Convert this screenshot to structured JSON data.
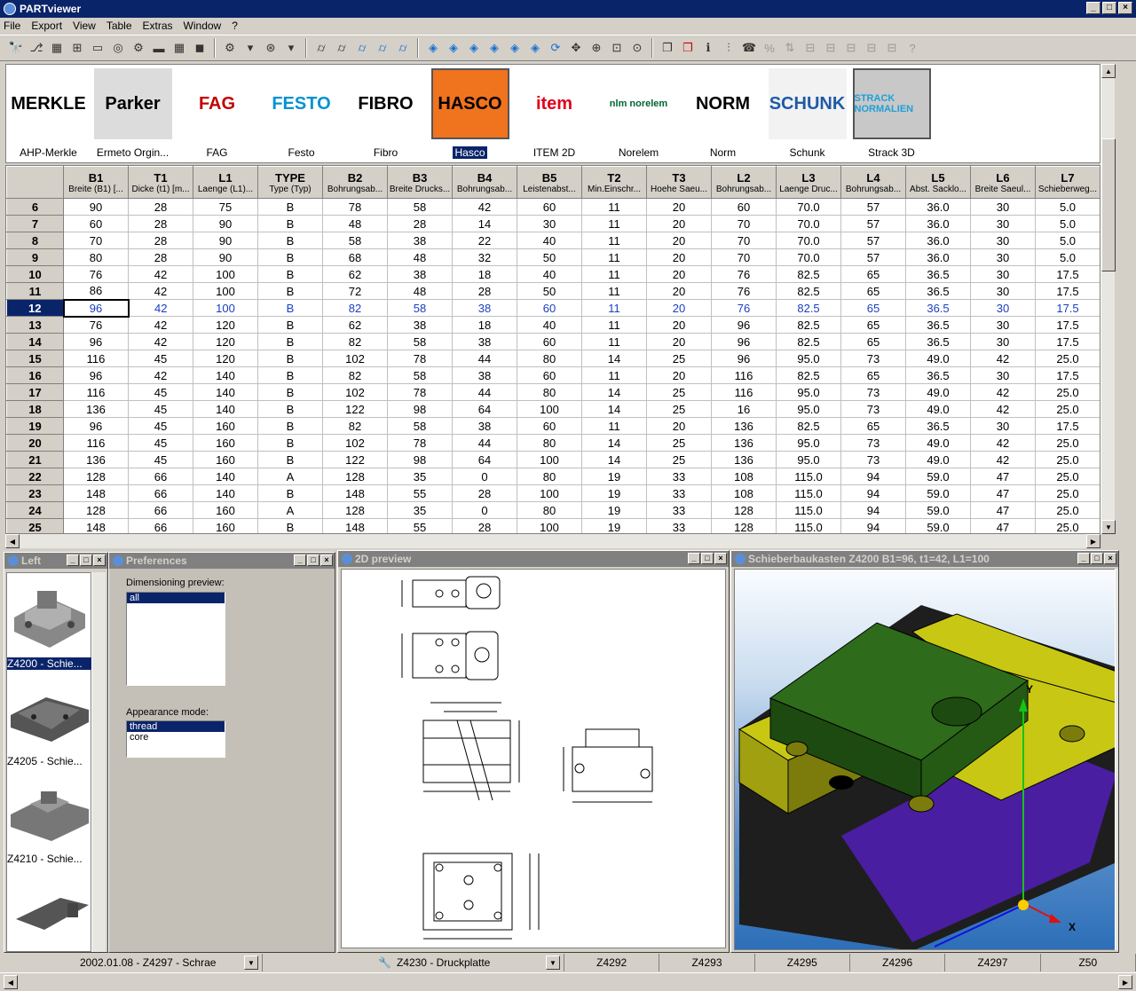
{
  "app": {
    "title": "PARTviewer"
  },
  "menu": [
    "File",
    "Export",
    "View",
    "Table",
    "Extras",
    "Window",
    "?"
  ],
  "logos": [
    {
      "label": "AHP-Merkle",
      "img": "MERKLE",
      "bg": "#ffffff",
      "fg": "#000000"
    },
    {
      "label": "Ermeto Orgin...",
      "img": "Parker",
      "bg": "#dcdcdc",
      "fg": "#000000"
    },
    {
      "label": "FAG",
      "img": "FAG",
      "bg": "#ffffff",
      "fg": "#c00000"
    },
    {
      "label": "Festo",
      "img": "FESTO",
      "bg": "#ffffff",
      "fg": "#0093d0"
    },
    {
      "label": "Fibro",
      "img": "FIBRO",
      "bg": "#ffffff",
      "fg": "#000000"
    },
    {
      "label": "Hasco",
      "img": "HASCO",
      "bg": "#f0731e",
      "fg": "#000000"
    },
    {
      "label": "ITEM 2D",
      "img": "item",
      "bg": "#ffffff",
      "fg": "#e2001a"
    },
    {
      "label": "Norelem",
      "img": "nlm norelem",
      "bg": "#ffffff",
      "fg": "#006633"
    },
    {
      "label": "Norm",
      "img": "NORM",
      "bg": "#ffffff",
      "fg": "#000000"
    },
    {
      "label": "Schunk",
      "img": "SCHUNK",
      "bg": "#f2f2f2",
      "fg": "#1e5aa8"
    },
    {
      "label": "Strack 3D",
      "img": "STRACK NORMALIEN",
      "bg": "#c8c8c8",
      "fg": "#1ea0d8"
    }
  ],
  "table": {
    "columns": [
      {
        "code": "B1",
        "desc": "Breite (B1) [..."
      },
      {
        "code": "T1",
        "desc": "Dicke (t1) [m..."
      },
      {
        "code": "L1",
        "desc": "Laenge (L1)..."
      },
      {
        "code": "TYPE",
        "desc": "Type (Typ)"
      },
      {
        "code": "B2",
        "desc": "Bohrungsab..."
      },
      {
        "code": "B3",
        "desc": "Breite Drucks..."
      },
      {
        "code": "B4",
        "desc": "Bohrungsab..."
      },
      {
        "code": "B5",
        "desc": "Leistenabst..."
      },
      {
        "code": "T2",
        "desc": "Min.Einschr..."
      },
      {
        "code": "T3",
        "desc": "Hoehe Saeu..."
      },
      {
        "code": "L2",
        "desc": "Bohrungsab..."
      },
      {
        "code": "L3",
        "desc": "Laenge Druc..."
      },
      {
        "code": "L4",
        "desc": "Bohrungsab..."
      },
      {
        "code": "L5",
        "desc": "Abst. Sacklo..."
      },
      {
        "code": "L6",
        "desc": "Breite Saeul..."
      },
      {
        "code": "L7",
        "desc": "Schieberweg..."
      }
    ],
    "rows": [
      [
        "6",
        "90",
        "28",
        "75",
        "B",
        "78",
        "58",
        "42",
        "60",
        "11",
        "20",
        "60",
        "70.0",
        "57",
        "36.0",
        "30",
        "5.0"
      ],
      [
        "7",
        "60",
        "28",
        "90",
        "B",
        "48",
        "28",
        "14",
        "30",
        "11",
        "20",
        "70",
        "70.0",
        "57",
        "36.0",
        "30",
        "5.0"
      ],
      [
        "8",
        "70",
        "28",
        "90",
        "B",
        "58",
        "38",
        "22",
        "40",
        "11",
        "20",
        "70",
        "70.0",
        "57",
        "36.0",
        "30",
        "5.0"
      ],
      [
        "9",
        "80",
        "28",
        "90",
        "B",
        "68",
        "48",
        "32",
        "50",
        "11",
        "20",
        "70",
        "70.0",
        "57",
        "36.0",
        "30",
        "5.0"
      ],
      [
        "10",
        "76",
        "42",
        "100",
        "B",
        "62",
        "38",
        "18",
        "40",
        "11",
        "20",
        "76",
        "82.5",
        "65",
        "36.5",
        "30",
        "17.5"
      ],
      [
        "11",
        "86",
        "42",
        "100",
        "B",
        "72",
        "48",
        "28",
        "50",
        "11",
        "20",
        "76",
        "82.5",
        "65",
        "36.5",
        "30",
        "17.5"
      ],
      [
        "12",
        "96",
        "42",
        "100",
        "B",
        "82",
        "58",
        "38",
        "60",
        "11",
        "20",
        "76",
        "82.5",
        "65",
        "36.5",
        "30",
        "17.5"
      ],
      [
        "13",
        "76",
        "42",
        "120",
        "B",
        "62",
        "38",
        "18",
        "40",
        "11",
        "20",
        "96",
        "82.5",
        "65",
        "36.5",
        "30",
        "17.5"
      ],
      [
        "14",
        "96",
        "42",
        "120",
        "B",
        "82",
        "58",
        "38",
        "60",
        "11",
        "20",
        "96",
        "82.5",
        "65",
        "36.5",
        "30",
        "17.5"
      ],
      [
        "15",
        "116",
        "45",
        "120",
        "B",
        "102",
        "78",
        "44",
        "80",
        "14",
        "25",
        "96",
        "95.0",
        "73",
        "49.0",
        "42",
        "25.0"
      ],
      [
        "16",
        "96",
        "42",
        "140",
        "B",
        "82",
        "58",
        "38",
        "60",
        "11",
        "20",
        "116",
        "82.5",
        "65",
        "36.5",
        "30",
        "17.5"
      ],
      [
        "17",
        "116",
        "45",
        "140",
        "B",
        "102",
        "78",
        "44",
        "80",
        "14",
        "25",
        "116",
        "95.0",
        "73",
        "49.0",
        "42",
        "25.0"
      ],
      [
        "18",
        "136",
        "45",
        "140",
        "B",
        "122",
        "98",
        "64",
        "100",
        "14",
        "25",
        "16",
        "95.0",
        "73",
        "49.0",
        "42",
        "25.0"
      ],
      [
        "19",
        "96",
        "45",
        "160",
        "B",
        "82",
        "58",
        "38",
        "60",
        "11",
        "20",
        "136",
        "82.5",
        "65",
        "36.5",
        "30",
        "17.5"
      ],
      [
        "20",
        "116",
        "45",
        "160",
        "B",
        "102",
        "78",
        "44",
        "80",
        "14",
        "25",
        "136",
        "95.0",
        "73",
        "49.0",
        "42",
        "25.0"
      ],
      [
        "21",
        "136",
        "45",
        "160",
        "B",
        "122",
        "98",
        "64",
        "100",
        "14",
        "25",
        "136",
        "95.0",
        "73",
        "49.0",
        "42",
        "25.0"
      ],
      [
        "22",
        "128",
        "66",
        "140",
        "A",
        "128",
        "35",
        "0",
        "80",
        "19",
        "33",
        "108",
        "115.0",
        "94",
        "59.0",
        "47",
        "25.0"
      ],
      [
        "23",
        "148",
        "66",
        "140",
        "B",
        "148",
        "55",
        "28",
        "100",
        "19",
        "33",
        "108",
        "115.0",
        "94",
        "59.0",
        "47",
        "25.0"
      ],
      [
        "24",
        "128",
        "66",
        "160",
        "A",
        "128",
        "35",
        "0",
        "80",
        "19",
        "33",
        "128",
        "115.0",
        "94",
        "59.0",
        "47",
        "25.0"
      ],
      [
        "25",
        "148",
        "66",
        "160",
        "B",
        "148",
        "55",
        "28",
        "100",
        "19",
        "33",
        "128",
        "115.0",
        "94",
        "59.0",
        "47",
        "25.0"
      ]
    ],
    "selected_row": "12"
  },
  "panels": {
    "left": {
      "title": "Left",
      "items": [
        "Z4200 - Schie...",
        "Z4205 - Schie...",
        "Z4210 - Schie...",
        ""
      ]
    },
    "preferences": {
      "title": "Preferences",
      "dim_label": "Dimensioning preview:",
      "dim_options": [
        "all"
      ],
      "appearance_label": "Appearance mode:",
      "appearance_options": [
        "thread",
        "core"
      ]
    },
    "preview2d": {
      "title": "2D preview"
    },
    "preview3d": {
      "title": "Schieberbaukasten Z4200 B1=96, t1=42, L1=100",
      "axis_x": "X",
      "axis_y": "Y"
    }
  },
  "status": {
    "left_item": "2002.01.08 - Z4297 - Schrae",
    "mid_item": "Z4230 - Druckplatte",
    "cols": [
      "Z4292",
      "Z4293",
      "Z4295",
      "Z4296",
      "Z4297",
      "Z50"
    ]
  },
  "colors": {
    "titlebar": "#0a246a",
    "face": "#d4d0c8",
    "model_green": "#2e6b1a",
    "model_yellow": "#c8c814",
    "model_purple": "#4a1ea0",
    "viewport": "#2c6fb8"
  }
}
